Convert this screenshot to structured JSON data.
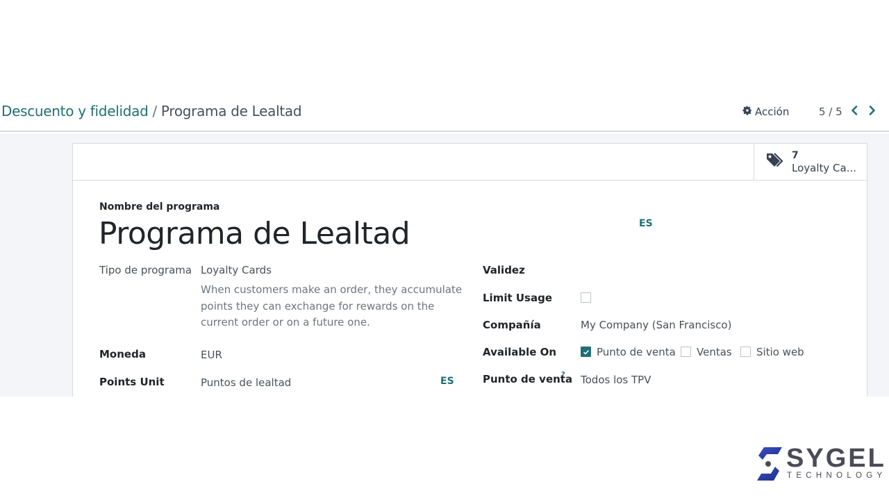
{
  "breadcrumb": {
    "parent": "Descuento y fidelidad",
    "separator": "/",
    "current": "Programa de Lealtad"
  },
  "toolbar": {
    "action_label": "Acción",
    "action_icon": "gear-icon",
    "pager": "5 / 5",
    "prev_icon": "chevron-left-icon",
    "next_icon": "chevron-right-icon"
  },
  "smart_button": {
    "icon": "tags-icon",
    "count": "7",
    "label": "Loyalty Ca..."
  },
  "form": {
    "title_label": "Nombre del programa",
    "title_value": "Programa de Lealtad",
    "title_lang": "ES",
    "left": {
      "program_type_label": "Tipo de programa",
      "program_type_value": "Loyalty Cards",
      "program_type_description": "When customers make an order, they accumulate points they can exchange for rewards on the current order or on a future one.",
      "currency_label": "Moneda",
      "currency_value": "EUR",
      "points_unit_label": "Points Unit",
      "points_unit_value": "Puntos de lealtad",
      "points_unit_lang": "ES"
    },
    "right": {
      "validity_label": "Validez",
      "limit_usage_label": "Limit Usage",
      "limit_usage_checked": false,
      "company_label": "Compañía",
      "company_value": "My Company (San Francisco)",
      "available_on_label": "Available On",
      "available_on": [
        {
          "label": "Punto de venta",
          "checked": true
        },
        {
          "label": "Ventas",
          "checked": false
        },
        {
          "label": "Sitio web",
          "checked": false
        }
      ],
      "pos_label": "Punto de venta",
      "pos_help": "?",
      "pos_value": "Todos los TPV"
    }
  },
  "branding": {
    "logo_name": "SYGEL",
    "logo_sub": "TECHNOLOGY",
    "colors": {
      "accent": "#1f6f73",
      "logo_blue": "#2b3fa8",
      "logo_gray": "#4a4b57"
    }
  }
}
